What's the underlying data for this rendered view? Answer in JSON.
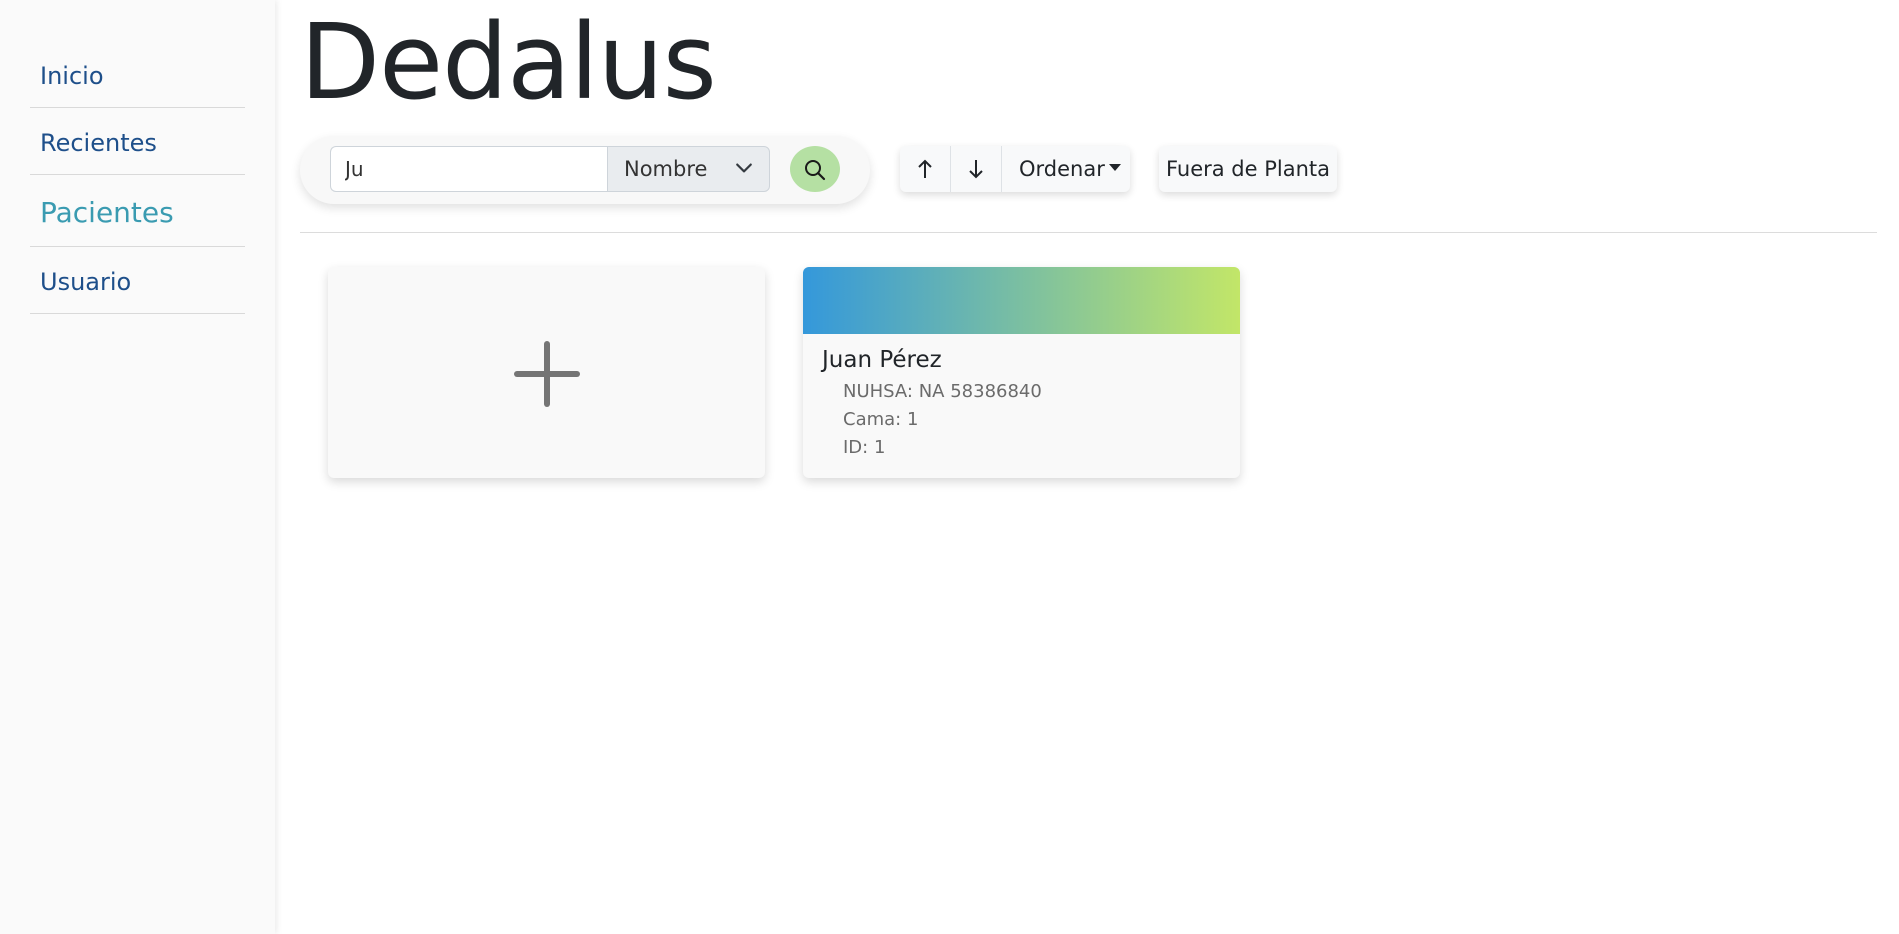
{
  "sidebar": {
    "items": [
      {
        "label": "Inicio",
        "active": false
      },
      {
        "label": "Recientes",
        "active": false
      },
      {
        "label": "Pacientes",
        "active": true
      },
      {
        "label": "Usuario",
        "active": false
      }
    ]
  },
  "header": {
    "title": "Dedalus"
  },
  "search": {
    "value": "Ju",
    "field_selected": "Nombre",
    "search_icon": "search-icon",
    "button_color": "#b5e0a3"
  },
  "toolbar": {
    "sort_asc_icon": "arrow-up-icon",
    "sort_desc_icon": "arrow-down-icon",
    "order_label": "Ordenar",
    "outside_label": "Fuera de Planta"
  },
  "cards": {
    "add_icon": "plus-icon",
    "patients": [
      {
        "name": "Juan Pérez",
        "nuhsa": "NUHSA: NA 58386840",
        "cama": "Cama: 1",
        "id": "ID: 1",
        "gradient_from": "#3498db",
        "gradient_to": "#c2e668"
      }
    ]
  },
  "colors": {
    "nav_text": "#1e4f8a",
    "nav_active": "#3a9bb1"
  }
}
